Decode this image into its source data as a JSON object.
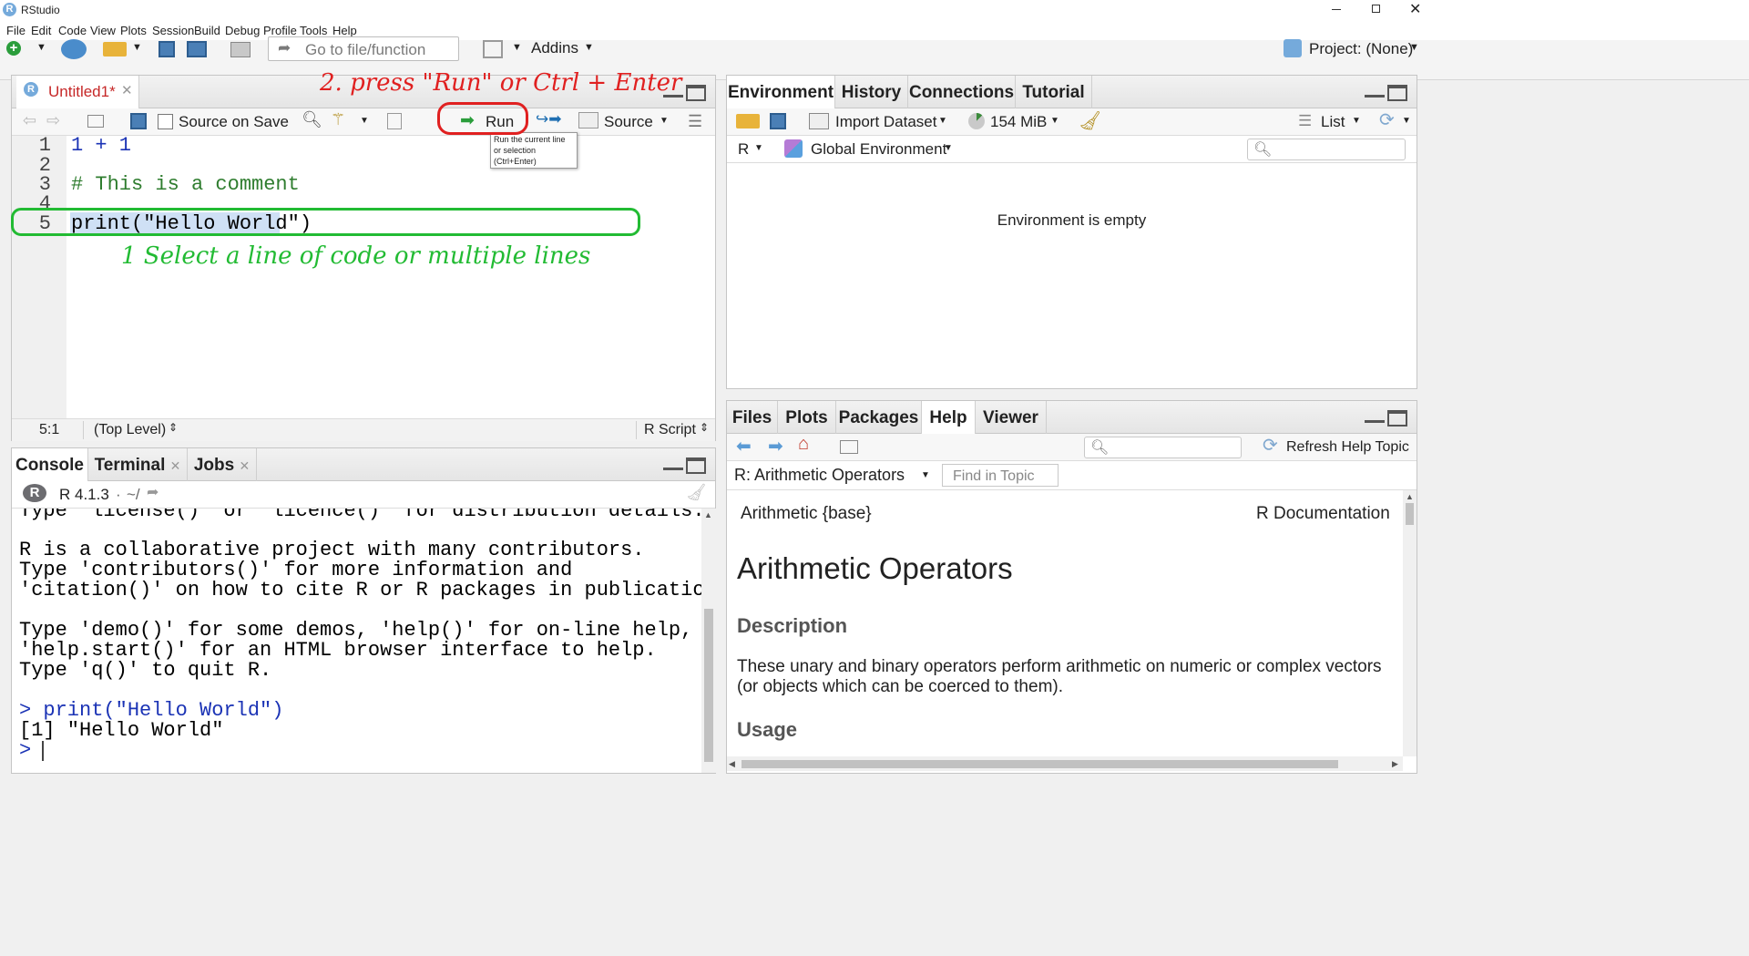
{
  "app": {
    "title": "RStudio"
  },
  "menu": [
    "File",
    "Edit",
    "Code",
    "View",
    "Plots",
    "Session",
    "Build",
    "Debug",
    "Profile",
    "Tools",
    "Help"
  ],
  "toolbar": {
    "goto_placeholder": "Go to file/function",
    "addins": "Addins",
    "project": "Project: (None)"
  },
  "editor": {
    "tab": "Untitled1*",
    "source_on_save": "Source on Save",
    "run": "Run",
    "source": "Source",
    "tooltip": [
      "Run the current line",
      "or selection",
      "(Ctrl+Enter)"
    ],
    "lines": [
      {
        "n": "1",
        "text": "1 + 1"
      },
      {
        "n": "2",
        "text": ""
      },
      {
        "n": "3",
        "text": "# This is a comment"
      },
      {
        "n": "4",
        "text": ""
      },
      {
        "n": "5",
        "text": "print(\"Hello World\")"
      }
    ],
    "status": {
      "pos": "5:1",
      "scope": "(Top Level)",
      "type": "R Script"
    }
  },
  "annotations": {
    "step1": "1 Select a line of code or multiple lines",
    "step2": "2. press \"Run\" or Ctrl + Enter",
    "color_green": "#22bb33",
    "color_red": "#e02020"
  },
  "console": {
    "tabs": [
      "Console",
      "Terminal",
      "Jobs"
    ],
    "version": "R 4.1.3",
    "path": "~/",
    "lines": [
      "Type 'license()' or 'licence()' for distribution details.",
      "",
      "R is a collaborative project with many contributors.",
      "Type 'contributors()' for more information and",
      "'citation()' on how to cite R or R packages in publications.",
      "",
      "Type 'demo()' for some demos, 'help()' for on-line help, or",
      "'help.start()' for an HTML browser interface to help.",
      "Type 'q()' to quit R.",
      ""
    ],
    "input": "> print(\"Hello World\")",
    "output": "[1] \"Hello World\"",
    "prompt": ">"
  },
  "env": {
    "tabs": [
      "Environment",
      "History",
      "Connections",
      "Tutorial"
    ],
    "import": "Import Dataset",
    "memory": "154 MiB",
    "list": "List",
    "lang": "R",
    "scope": "Global Environment",
    "empty": "Environment is empty"
  },
  "files": {
    "tabs": [
      "Files",
      "Plots",
      "Packages",
      "Help",
      "Viewer"
    ],
    "refresh": "Refresh Help Topic",
    "topic": "R: Arithmetic Operators",
    "find_placeholder": "Find in Topic",
    "doc": {
      "left": "Arithmetic {base}",
      "right": "R Documentation",
      "title": "Arithmetic Operators",
      "h_desc": "Description",
      "desc": "These unary and binary operators perform arithmetic on numeric or complex vectors (or objects which can be coerced to them).",
      "h_usage": "Usage"
    }
  }
}
